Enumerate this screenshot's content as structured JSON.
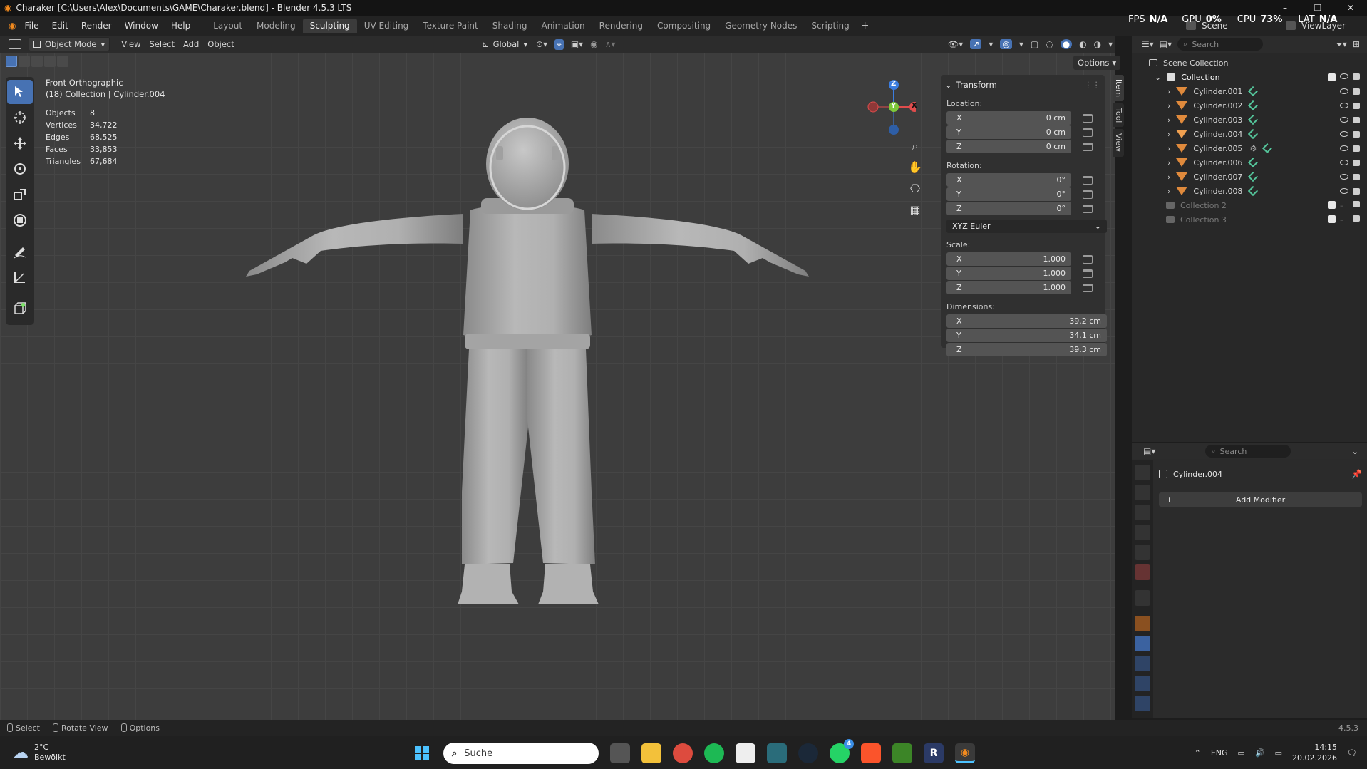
{
  "window": {
    "title": "Charaker [C:\\Users\\Alex\\Documents\\GAME\\Charaker.blend] - Blender 4.5.3 LTS",
    "controls": {
      "minimize": "–",
      "maximize": "❐",
      "close": "✕"
    }
  },
  "menubar": {
    "menus": [
      "File",
      "Edit",
      "Render",
      "Window",
      "Help"
    ],
    "workspaces": [
      "Layout",
      "Modeling",
      "Sculpting",
      "UV Editing",
      "Texture Paint",
      "Shading",
      "Animation",
      "Rendering",
      "Compositing",
      "Geometry Nodes",
      "Scripting"
    ],
    "active_workspace": "Sculpting",
    "add_label": "+",
    "scene_label": "Scene",
    "viewlayer_label": "ViewLayer"
  },
  "overlay_stats": {
    "fps": {
      "label": "FPS",
      "value": "N/A"
    },
    "gpu": {
      "label": "GPU",
      "value": "0%"
    },
    "cpu": {
      "label": "CPU",
      "value": "73%"
    },
    "lat": {
      "label": "LAT",
      "value": "N/A"
    }
  },
  "viewport_header": {
    "mode": "Object Mode",
    "menus": [
      "View",
      "Select",
      "Add",
      "Object"
    ],
    "orientation": "Global",
    "options_label": "Options"
  },
  "viewport_info": {
    "view_name": "Front Orthographic",
    "collection_line": "(18) Collection | Cylinder.004",
    "stats": [
      {
        "label": "Objects",
        "value": "8"
      },
      {
        "label": "Vertices",
        "value": "34,722"
      },
      {
        "label": "Edges",
        "value": "68,525"
      },
      {
        "label": "Faces",
        "value": "33,853"
      },
      {
        "label": "Triangles",
        "value": "67,684"
      }
    ]
  },
  "gizmo": {
    "x": "X",
    "y": "Y",
    "z": "Z"
  },
  "npanel": {
    "section": "Transform",
    "location_label": "Location:",
    "location": [
      {
        "axis": "X",
        "value": "0 cm"
      },
      {
        "axis": "Y",
        "value": "0 cm"
      },
      {
        "axis": "Z",
        "value": "0 cm"
      }
    ],
    "rotation_label": "Rotation:",
    "rotation": [
      {
        "axis": "X",
        "value": "0°"
      },
      {
        "axis": "Y",
        "value": "0°"
      },
      {
        "axis": "Z",
        "value": "0°"
      }
    ],
    "rotation_mode": "XYZ Euler",
    "scale_label": "Scale:",
    "scale": [
      {
        "axis": "X",
        "value": "1.000"
      },
      {
        "axis": "Y",
        "value": "1.000"
      },
      {
        "axis": "Z",
        "value": "1.000"
      }
    ],
    "dimensions_label": "Dimensions:",
    "dimensions": [
      {
        "axis": "X",
        "value": "39.2 cm"
      },
      {
        "axis": "Y",
        "value": "34.1 cm"
      },
      {
        "axis": "Z",
        "value": "39.3 cm"
      }
    ],
    "tabs": [
      "Item",
      "Tool",
      "View"
    ]
  },
  "outliner": {
    "search_placeholder": "Search",
    "scene_collection": "Scene Collection",
    "collection": "Collection",
    "objects": [
      "Cylinder.001",
      "Cylinder.002",
      "Cylinder.003",
      "Cylinder.004",
      "Cylinder.005",
      "Cylinder.006",
      "Cylinder.007",
      "Cylinder.008"
    ],
    "other_collections": [
      "Collection 2",
      "Collection 3"
    ]
  },
  "properties": {
    "search_placeholder": "Search",
    "object_name": "Cylinder.004",
    "add_modifier": "Add Modifier"
  },
  "statusbar": {
    "select": "Select",
    "rotate": "Rotate View",
    "options": "Options",
    "version": "4.5.3"
  },
  "taskbar": {
    "weather_temp": "2°C",
    "weather_desc": "Bewölkt",
    "search_placeholder": "Suche",
    "language": "ENG",
    "time": "14:15",
    "date": "20.02.2026",
    "whatsapp_badge": "4"
  }
}
